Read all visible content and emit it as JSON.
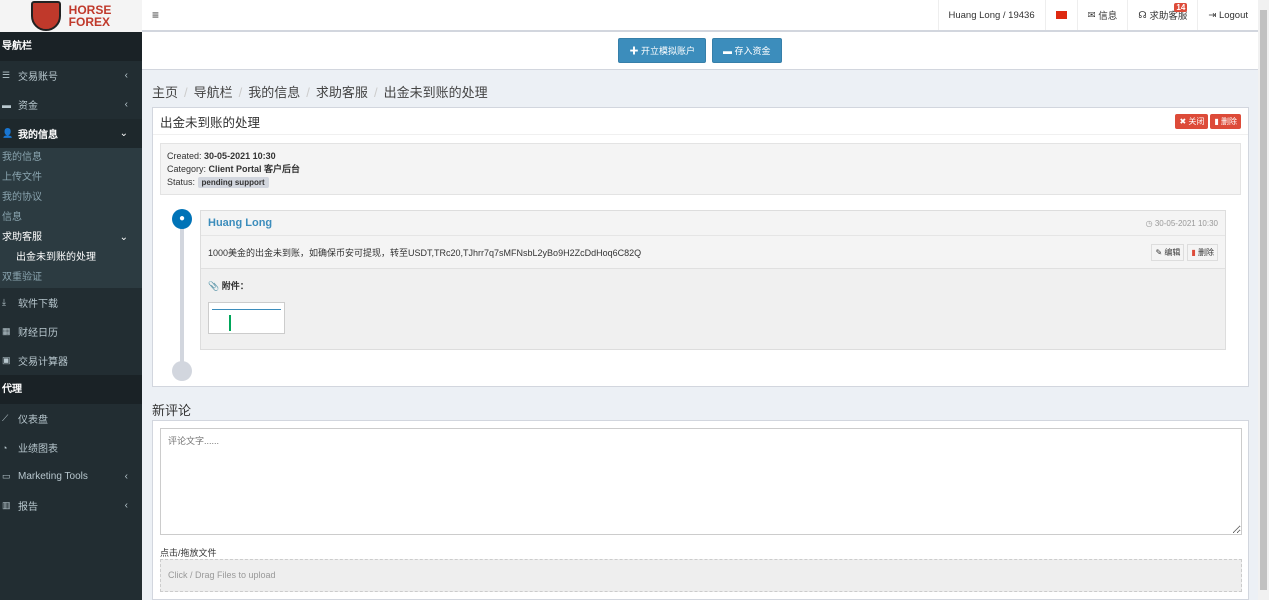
{
  "brand": {
    "line1": "HORSE",
    "line2": "FOREX"
  },
  "sidebar": {
    "header1": "导航栏",
    "items1": [
      {
        "label": "交易账号",
        "icon": "list-icon"
      },
      {
        "label": "资金",
        "icon": "wallet-icon"
      },
      {
        "label": "我的信息",
        "icon": "user-icon"
      }
    ],
    "sub": [
      "我的信息",
      "上传文件",
      "我的协议",
      "信息",
      "求助客服",
      "出金未到账的处理",
      "双重验证"
    ],
    "items2": [
      {
        "label": "软件下载",
        "icon": "download-icon"
      },
      {
        "label": "财经日历",
        "icon": "calendar-icon"
      },
      {
        "label": "交易计算器",
        "icon": "calculator-icon"
      }
    ],
    "header2": "代理",
    "items3": [
      {
        "label": "仪表盘",
        "icon": "chart-line-icon"
      },
      {
        "label": "业绩图表",
        "icon": "pie-chart-icon"
      },
      {
        "label": "Marketing Tools",
        "icon": "briefcase-icon"
      },
      {
        "label": "报告",
        "icon": "bar-chart-icon"
      }
    ]
  },
  "topbar": {
    "user": "Huang Long / 19436",
    "messages": "信息",
    "support": "求助客服",
    "support_badge": "14",
    "logout": "Logout"
  },
  "actions": {
    "demo": "开立模拟账户",
    "deposit": "存入资金"
  },
  "breadcrumb": [
    "主页",
    "导航栏",
    "我的信息",
    "求助客服",
    "出金未到账的处理"
  ],
  "ticket": {
    "title": "出金未到账的处理",
    "close": "关闭",
    "delete": "删除",
    "created_label": "Created:",
    "created": "30-05-2021 10:30",
    "category_label": "Category:",
    "category": "Client Portal 客户后台",
    "status_label": "Status:",
    "status": "pending support",
    "message": {
      "author": "Huang Long",
      "time": "30-05-2021 10:30",
      "text": "1000美金的出金未到账，如确保币安可提现，转至USDT,TRc20,TJhrr7q7sMFNsbL2yBo9H2ZcDdHoq6C82Q",
      "edit": "编辑",
      "delete": "删除",
      "attachments": "附件："
    }
  },
  "comment": {
    "title": "新评论",
    "placeholder": "评论文字......",
    "upload_label": "点击/拖放文件",
    "dropzone": "Click / Drag Files to upload"
  }
}
